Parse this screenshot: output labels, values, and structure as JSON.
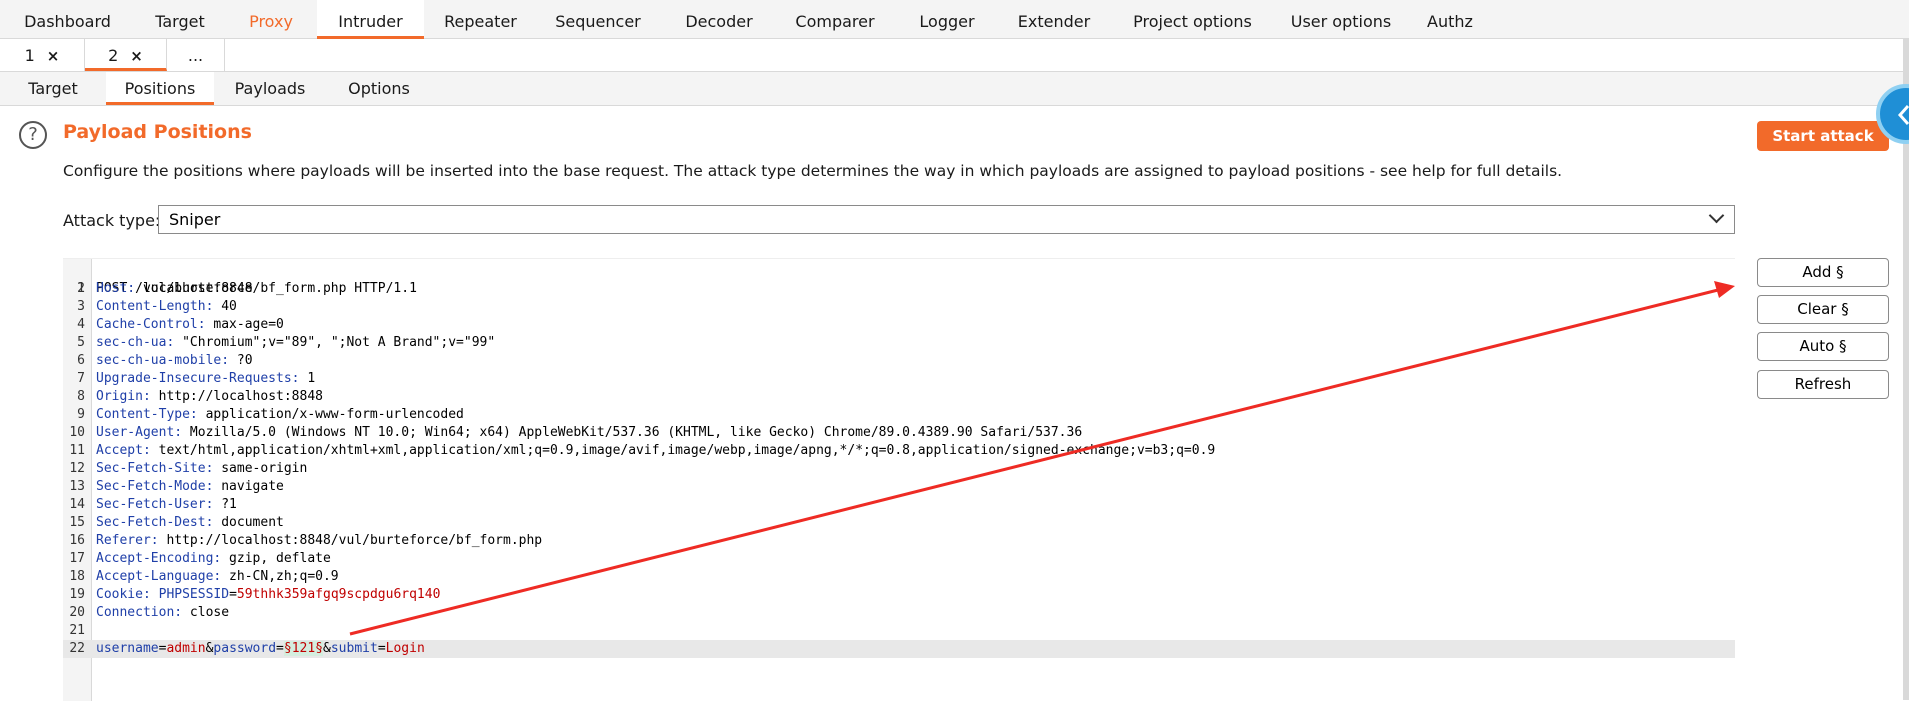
{
  "top_tabs": [
    {
      "label": "Dashboard"
    },
    {
      "label": "Target"
    },
    {
      "label": "Proxy"
    },
    {
      "label": "Intruder"
    },
    {
      "label": "Repeater"
    },
    {
      "label": "Sequencer"
    },
    {
      "label": "Decoder"
    },
    {
      "label": "Comparer"
    },
    {
      "label": "Logger"
    },
    {
      "label": "Extender"
    },
    {
      "label": "Project options"
    },
    {
      "label": "User options"
    },
    {
      "label": "Authz"
    }
  ],
  "instance_tabs": [
    {
      "label": "1",
      "close": "×"
    },
    {
      "label": "2",
      "close": "×"
    },
    {
      "label": "..."
    }
  ],
  "sub_tabs": [
    {
      "label": "Target"
    },
    {
      "label": "Positions"
    },
    {
      "label": "Payloads"
    },
    {
      "label": "Options"
    }
  ],
  "section": {
    "help_glyph": "?",
    "title": "Payload Positions",
    "description": "Configure the positions where payloads will be inserted into the base request. The attack type determines the way in which payloads are assigned to payload positions - see help for full details."
  },
  "start_attack_label": "Start attack",
  "attack_type": {
    "label": "Attack type:",
    "value": "Sniper"
  },
  "side_buttons": {
    "add": "Add §",
    "clear": "Clear §",
    "auto": "Auto §",
    "refresh": "Refresh"
  },
  "request": {
    "l1": "POST /vul/burteforce/bf_form.php HTTP/1.1",
    "headers": [
      {
        "name": "Host:",
        "value": " localhost:8848"
      },
      {
        "name": "Content-Length:",
        "value": " 40"
      },
      {
        "name": "Cache-Control:",
        "value": " max-age=0"
      },
      {
        "name": "sec-ch-ua:",
        "value": " \"Chromium\";v=\"89\", \";Not A Brand\";v=\"99\""
      },
      {
        "name": "sec-ch-ua-mobile:",
        "value": " ?0"
      },
      {
        "name": "Upgrade-Insecure-Requests:",
        "value": " 1"
      },
      {
        "name": "Origin:",
        "value": " http://localhost:8848"
      },
      {
        "name": "Content-Type:",
        "value": " application/x-www-form-urlencoded"
      },
      {
        "name": "User-Agent:",
        "value": " Mozilla/5.0 (Windows NT 10.0; Win64; x64) AppleWebKit/537.36 (KHTML, like Gecko) Chrome/89.0.4389.90 Safari/537.36"
      },
      {
        "name": "Accept:",
        "value": " text/html,application/xhtml+xml,application/xml;q=0.9,image/avif,image/webp,image/apng,*/*;q=0.8,application/signed-exchange;v=b3;q=0.9"
      },
      {
        "name": "Sec-Fetch-Site:",
        "value": " same-origin"
      },
      {
        "name": "Sec-Fetch-Mode:",
        "value": " navigate"
      },
      {
        "name": "Sec-Fetch-User:",
        "value": " ?1"
      },
      {
        "name": "Sec-Fetch-Dest:",
        "value": " document"
      },
      {
        "name": "Referer:",
        "value": " http://localhost:8848/vul/burteforce/bf_form.php"
      },
      {
        "name": "Accept-Encoding:",
        "value": " gzip, deflate"
      },
      {
        "name": "Accept-Language:",
        "value": " zh-CN,zh;q=0.9"
      }
    ],
    "cookie": {
      "name": "Cookie:",
      "key": "PHPSESSID",
      "eq": "=",
      "value": "59thhk359afgq9scpdgu6rq140"
    },
    "connection": {
      "name": "Connection:",
      "value": " close"
    },
    "body": {
      "k1": "username",
      "eq1": "=",
      "v1": "admin",
      "amp1": "&",
      "k2": "password",
      "eq2": "=",
      "marked": "§121§",
      "amp2": "&",
      "k3": "submit",
      "eq3": "=",
      "v3": "Login"
    }
  },
  "colors": {
    "accent": "#f26a2a",
    "annotation_arrow": "#ee2b24"
  }
}
